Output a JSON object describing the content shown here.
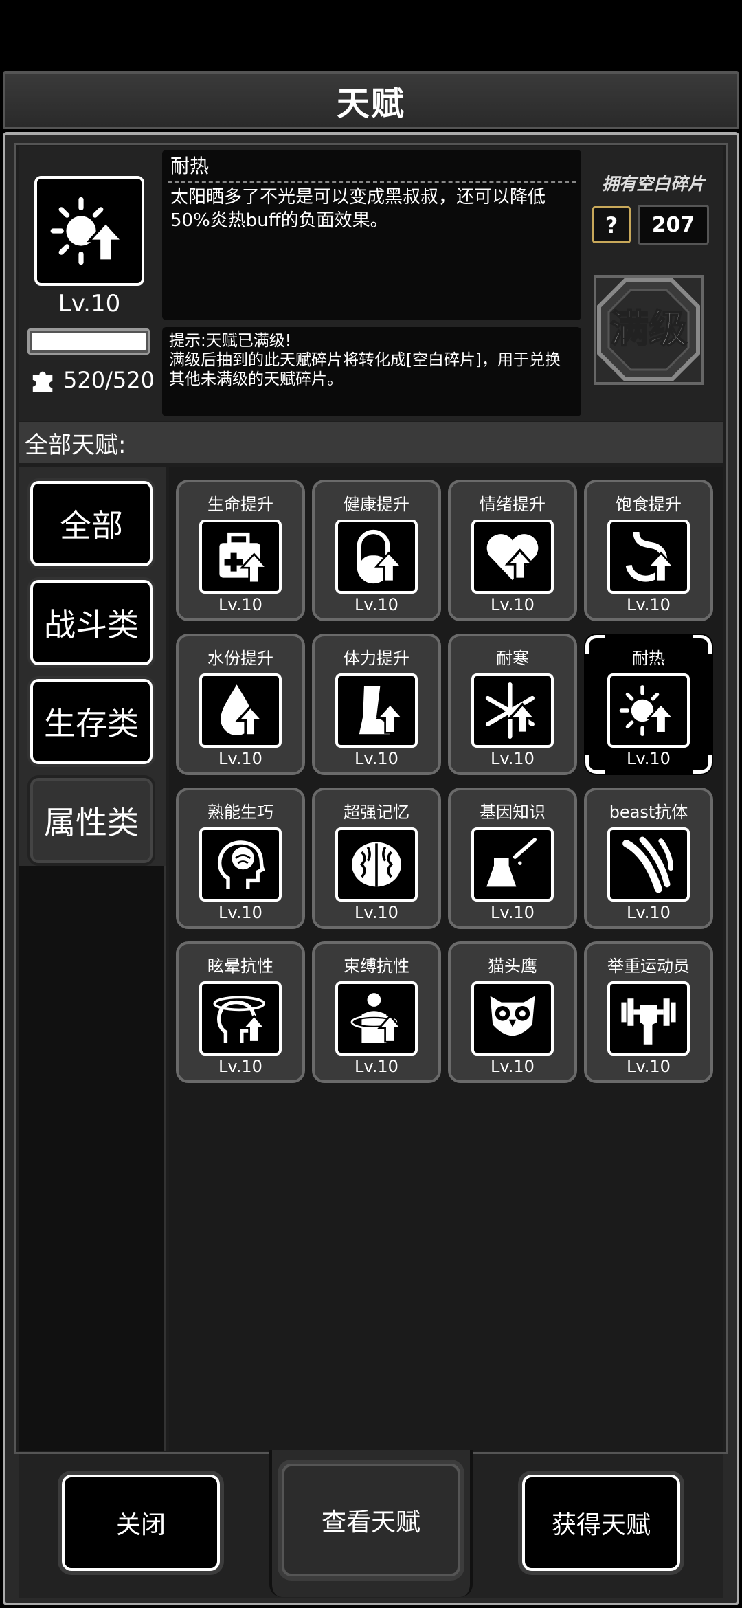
{
  "window": {
    "title": "天赋"
  },
  "selected_talent": {
    "name": "耐热",
    "description": "太阳晒多了不光是可以变成黑叔叔，还可以降低50%炎热buff的负面效果。",
    "level": "Lv.10",
    "progress": 1.0,
    "fragments": "520/520",
    "icon": "sun-arrow-icon"
  },
  "hint": {
    "line1": "提示:天赋已满级!",
    "line2": "满级后抽到的此天赋碎片将转化成[空白碎片]，用于兑换其他未满级的天赋碎片。"
  },
  "blank_fragments": {
    "label": "拥有空白碎片",
    "count": "207"
  },
  "max_level_badge": "满级",
  "all_talents_label": "全部天赋:",
  "categories": [
    {
      "label": "全部",
      "active": false
    },
    {
      "label": "战斗类",
      "active": false
    },
    {
      "label": "生存类",
      "active": false
    },
    {
      "label": "属性类",
      "active": true
    }
  ],
  "talents": [
    {
      "name": "生命提升",
      "level": "Lv.10",
      "icon": "medkit-arrow-icon"
    },
    {
      "name": "健康提升",
      "level": "Lv.10",
      "icon": "pill-arrow-icon"
    },
    {
      "name": "情绪提升",
      "level": "Lv.10",
      "icon": "heart-arrow-icon"
    },
    {
      "name": "饱食提升",
      "level": "Lv.10",
      "icon": "stomach-arrow-icon"
    },
    {
      "name": "水份提升",
      "level": "Lv.10",
      "icon": "drop-arrow-icon"
    },
    {
      "name": "体力提升",
      "level": "Lv.10",
      "icon": "leg-arrow-icon"
    },
    {
      "name": "耐寒",
      "level": "Lv.10",
      "icon": "snowflake-arrow-icon"
    },
    {
      "name": "耐热",
      "level": "Lv.10",
      "icon": "sun-arrow-icon",
      "selected": true
    },
    {
      "name": "熟能生巧",
      "level": "Lv.10",
      "icon": "head-brain-icon"
    },
    {
      "name": "超强记忆",
      "level": "Lv.10",
      "icon": "brain-icon"
    },
    {
      "name": "基因知识",
      "level": "Lv.10",
      "icon": "flask-icon"
    },
    {
      "name": "beast抗体",
      "level": "Lv.10",
      "icon": "claw-icon"
    },
    {
      "name": "眩晕抗性",
      "level": "Lv.10",
      "icon": "dizzy-head-icon"
    },
    {
      "name": "束缚抗性",
      "level": "Lv.10",
      "icon": "bound-man-icon"
    },
    {
      "name": "猫头鹰",
      "level": "Lv.10",
      "icon": "owl-icon"
    },
    {
      "name": "举重运动员",
      "level": "Lv.10",
      "icon": "dumbbell-icon"
    }
  ],
  "buttons": {
    "close": "关闭",
    "view": "查看天赋",
    "get": "获得天赋"
  },
  "colors": {
    "panel": "#2a2a2a",
    "tile": "#3a3a3a",
    "gold": "#c8a85a"
  }
}
